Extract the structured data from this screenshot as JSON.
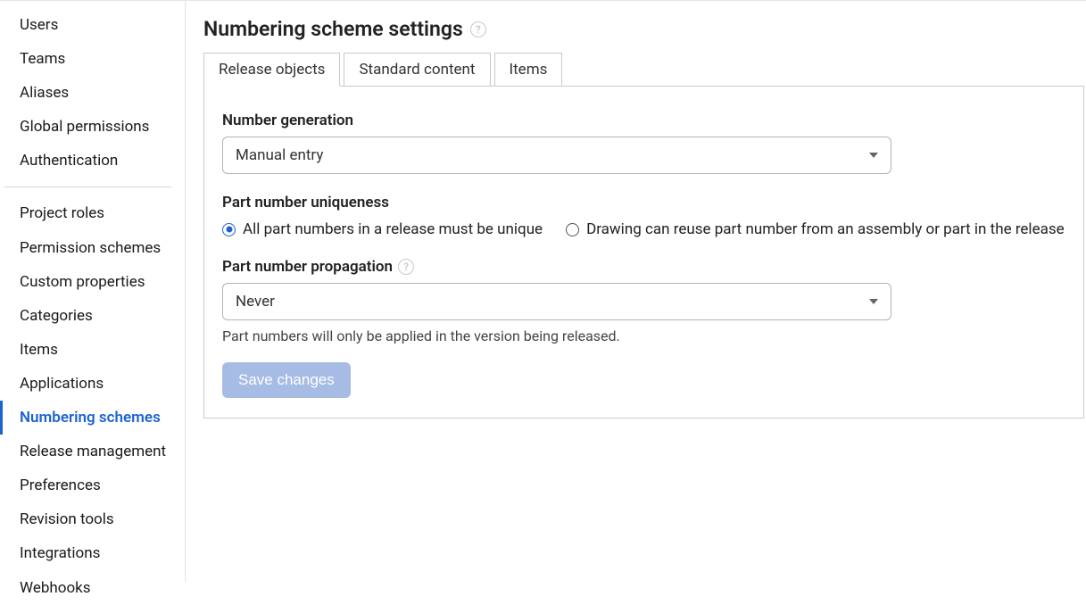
{
  "sidebar": {
    "group1": [
      {
        "label": "Users"
      },
      {
        "label": "Teams"
      },
      {
        "label": "Aliases"
      },
      {
        "label": "Global permissions"
      },
      {
        "label": "Authentication"
      }
    ],
    "group2": [
      {
        "label": "Project roles"
      },
      {
        "label": "Permission schemes"
      },
      {
        "label": "Custom properties"
      },
      {
        "label": "Categories"
      },
      {
        "label": "Items"
      },
      {
        "label": "Applications"
      },
      {
        "label": "Numbering schemes",
        "active": true
      },
      {
        "label": "Release management"
      },
      {
        "label": "Preferences"
      },
      {
        "label": "Revision tools"
      },
      {
        "label": "Integrations"
      },
      {
        "label": "Webhooks"
      }
    ]
  },
  "page": {
    "title": "Numbering scheme settings",
    "help_glyph": "?"
  },
  "tabs": [
    {
      "label": "Release objects",
      "active": true
    },
    {
      "label": "Standard content"
    },
    {
      "label": "Items"
    }
  ],
  "form": {
    "number_generation_label": "Number generation",
    "number_generation_value": "Manual entry",
    "uniqueness_label": "Part number uniqueness",
    "uniqueness_options": {
      "opt1": "All part numbers in a release must be unique",
      "opt2": "Drawing can reuse part number from an assembly or part in the release"
    },
    "propagation_label": "Part number propagation",
    "propagation_value": "Never",
    "propagation_hint": "Part numbers will only be applied in the version being released.",
    "save_label": "Save changes"
  }
}
